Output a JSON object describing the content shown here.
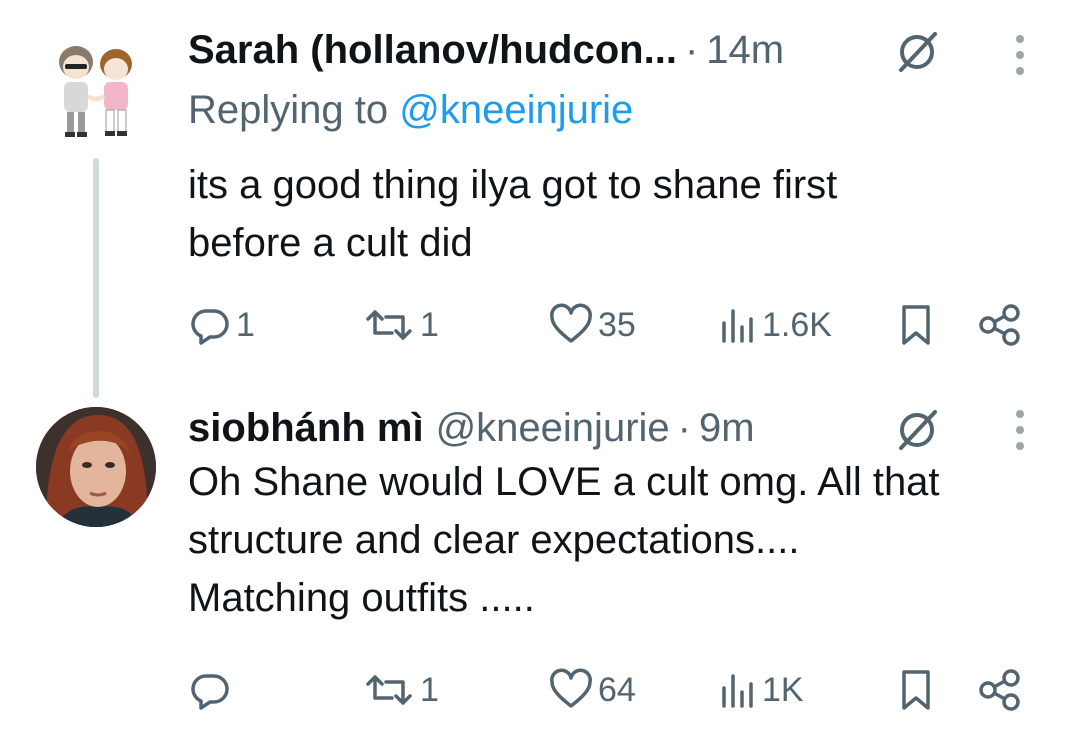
{
  "tweets": [
    {
      "name": "Sarah (hollanov/hudcon...",
      "handle": "",
      "time": "14m",
      "replying_prefix": "Replying to ",
      "replying_to": "@kneeinjurie",
      "text": "its a good thing ilya got to shane first\nbefore a cult did",
      "avatar": "chibi-couple-avatar",
      "stats": {
        "replies": "1",
        "reposts": "1",
        "likes": "35",
        "views": "1.6K"
      }
    },
    {
      "name": "siobhánh mì",
      "handle": "@kneeinjurie",
      "time": "9m",
      "text": "Oh Shane would LOVE a cult omg. All that\nstructure and clear expectations....\nMatching outfits .....",
      "avatar": "woman-portrait-avatar",
      "stats": {
        "replies": "",
        "reposts": "1",
        "likes": "64",
        "views": "1K"
      }
    }
  ],
  "icons": {
    "reply": "reply-icon",
    "repost": "repost-icon",
    "like": "like-icon",
    "views": "views-icon",
    "bookmark": "bookmark-icon",
    "share": "share-icon",
    "grok": "grok-icon",
    "more": "more-icon"
  },
  "colors": {
    "text": "#0f1419",
    "secondary": "#536471",
    "link": "#1d9bf0",
    "thread_line": "#cfd9de"
  }
}
